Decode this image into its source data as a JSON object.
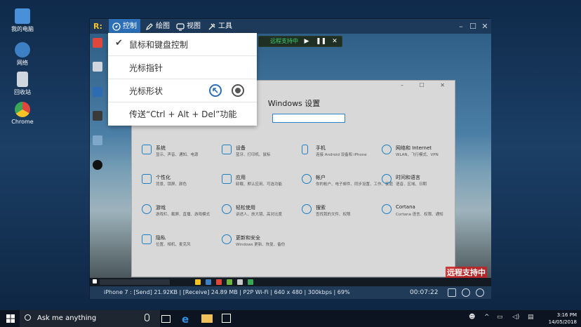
{
  "desktop": {
    "icons": [
      {
        "label": "我的电脑",
        "color": "#4a90d9"
      },
      {
        "label": "网络",
        "color": "#3c7fc2"
      },
      {
        "label": "回收站",
        "color": "#cfd6de"
      },
      {
        "label": "Chrome",
        "color": "#e0473c"
      }
    ]
  },
  "remote": {
    "tabs": [
      {
        "label": "控制"
      },
      {
        "label": "绘图"
      },
      {
        "label": "视图"
      },
      {
        "label": "工具"
      }
    ],
    "mini_bar_text": "远程支持中",
    "settings": {
      "title": "Windows 设置",
      "items": [
        {
          "name": "系统",
          "desc": "显示、声音、通知、电源"
        },
        {
          "name": "设备",
          "desc": "蓝牙、打印机、鼠标"
        },
        {
          "name": "手机",
          "desc": "连接 Android 设备和 iPhone"
        },
        {
          "name": "网络和 Internet",
          "desc": "WLAN、飞行模式、VPN"
        },
        {
          "name": "个性化",
          "desc": "背景、锁屏、颜色"
        },
        {
          "name": "应用",
          "desc": "卸载、默认应用、可选功能"
        },
        {
          "name": "帐户",
          "desc": "你的帐户、电子邮件、同步设置、工作、家庭"
        },
        {
          "name": "时间和语言",
          "desc": "语音、区域、日期"
        },
        {
          "name": "游戏",
          "desc": "游戏栏、截屏、直播、游戏模式"
        },
        {
          "name": "轻松使用",
          "desc": "讲述人、放大镜、高对比度"
        },
        {
          "name": "搜索",
          "desc": "查找我的文件、权限"
        },
        {
          "name": "Cortana",
          "desc": "Cortana 语言、权限、通知"
        },
        {
          "name": "隐私",
          "desc": "位置、相机、麦克风"
        },
        {
          "name": "更新和安全",
          "desc": "Windows 更新、恢复、备份"
        }
      ]
    },
    "support_label": "远程支持中",
    "status": {
      "text": "iPhone 7 : [Send] 21.92KB | [Receive] 24.89 MB | P2P Wi-Fi | 640 x 480 | 300kbps | 69%",
      "elapsed": "00:07:22"
    }
  },
  "menu": {
    "items": [
      {
        "label": "鼠标和键盘控制",
        "checked": true
      },
      {
        "label": "光标指针"
      },
      {
        "label": "光标形状"
      },
      {
        "label": "传送“Ctrl + Alt + Del”功能"
      }
    ]
  },
  "taskbar": {
    "search_placeholder": "Ask me anything",
    "clock_time": "3:16 PM",
    "clock_date": "14/05/2018"
  },
  "colors": {
    "accent": "#2c6fb7",
    "settings_icon": "#1b7fc1",
    "support_red": "#c81e1e"
  }
}
